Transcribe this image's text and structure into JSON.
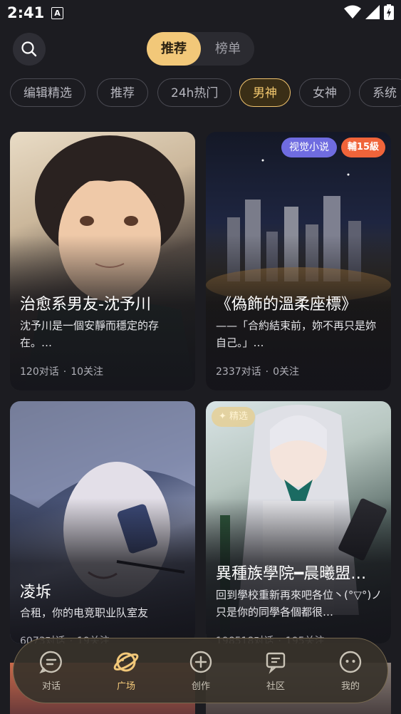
{
  "status_bar": {
    "time": "2:41",
    "notification_letter": "A"
  },
  "header": {
    "segments": [
      "推荐",
      "榜单"
    ],
    "active_segment": "推荐"
  },
  "chips": [
    "编辑精选",
    "推荐",
    "24h热门",
    "男神",
    "女神",
    "系统"
  ],
  "active_chip": "男神",
  "cards": [
    {
      "title": "治愈系男友-沈予川",
      "description": "沈予川是一個安靜而穩定的存在。…",
      "chats": "120对话",
      "follows": "10关注"
    },
    {
      "title": "《偽飾的溫柔座標》",
      "description": "——「合約結束前，妳不再只是妳自己。」…",
      "chats": "2337对话",
      "follows": "0关注",
      "tag_visual": "视觉小说",
      "tag_level": "輔15級"
    },
    {
      "title": "凌坼",
      "description": "合租，你的电竞职业队室友",
      "chats": "6073对话",
      "follows": "19关注"
    },
    {
      "title": "異種族學院━晨曦盟…",
      "description": "回到學校重新再來吧各位丶(°▽°)ノ只是你的同學各個都很…",
      "chats": "198518对话",
      "follows": "195关注",
      "tag_featured": "精选"
    }
  ],
  "nav": [
    {
      "label": "对话",
      "icon": "chat-icon"
    },
    {
      "label": "广场",
      "icon": "planet-icon"
    },
    {
      "label": "创作",
      "icon": "plus-circle-icon"
    },
    {
      "label": "社区",
      "icon": "community-icon"
    },
    {
      "label": "我的",
      "icon": "profile-icon"
    }
  ],
  "active_nav": "广场",
  "colors": {
    "accent": "#f2c879",
    "background": "#1c1c21",
    "level_tag": "#f0643a",
    "visual_tag": "#6f6ce0"
  }
}
